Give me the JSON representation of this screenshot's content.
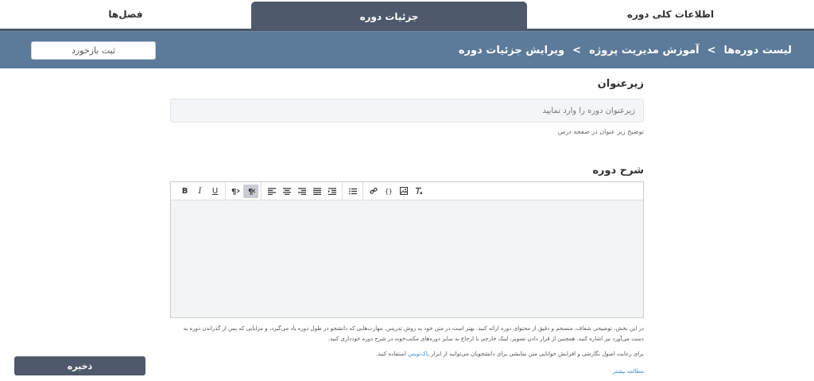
{
  "tabs": {
    "general": "اطلاعات کلی دوره",
    "details": "جزئیات دوره",
    "chapters": "فصل‌ها"
  },
  "breadcrumb": {
    "items": [
      "لیست دوره‌ها",
      "آموزش مدیریت پروژه",
      "ویرایش جزئیات دوره"
    ],
    "separator": ">"
  },
  "header": {
    "feedback_label": "ثبت بازخورد"
  },
  "form": {
    "subtitle_label": "زیرعنوان",
    "subtitle_placeholder": "زیرعنوان دوره را وارد نمایید",
    "subtitle_help": "توضیح زیر عنوان در صفحه درس",
    "description_label": "شرح دوره",
    "description_help_1": "در این بخش، توضیحی شفاف، منسجم و دقیق از محتوای دوره ارائه کنید. بهتر است در متن خود به روش تدریس، مهارت‌هایی که دانشجو در طول دوره یاد می‌گیرد، و مزایایی که پس از گذراندن دوره به دست می‌آورد نیز اشاره کنید. همچنین از قرار دادن تصویر، لینک خارجی یا ارجاع به سایر دوره‌های مکتب‌خونه در شرح دوره خودداری کنید.",
    "description_help_2_prefix": "برای رعایت اصول نگارشی و افزایش خوانایی متن نمایشی برای دانشجویان می‌توانید از ابزار",
    "description_help_2_link": "پاک‌نویس",
    "description_help_2_suffix": "استفاده کنید.",
    "read_more": "مطالعه بیشتر"
  },
  "toolbar": {
    "bold": "B",
    "italic": "I",
    "underline": "U",
    "icons": [
      "bold-icon",
      "italic-icon",
      "underline-icon",
      "ltr-icon",
      "rtl-icon",
      "align-left-icon",
      "align-center-icon",
      "align-right-icon",
      "align-justify-icon",
      "indent-icon",
      "bullet-list-icon",
      "link-icon",
      "code-icon",
      "image-icon",
      "clear-format-icon"
    ]
  },
  "footer": {
    "save_label": "ذخیره"
  },
  "colors": {
    "tab_active": "#4e5a6b",
    "header_band": "#5c7a99",
    "link": "#3a8fd1"
  }
}
